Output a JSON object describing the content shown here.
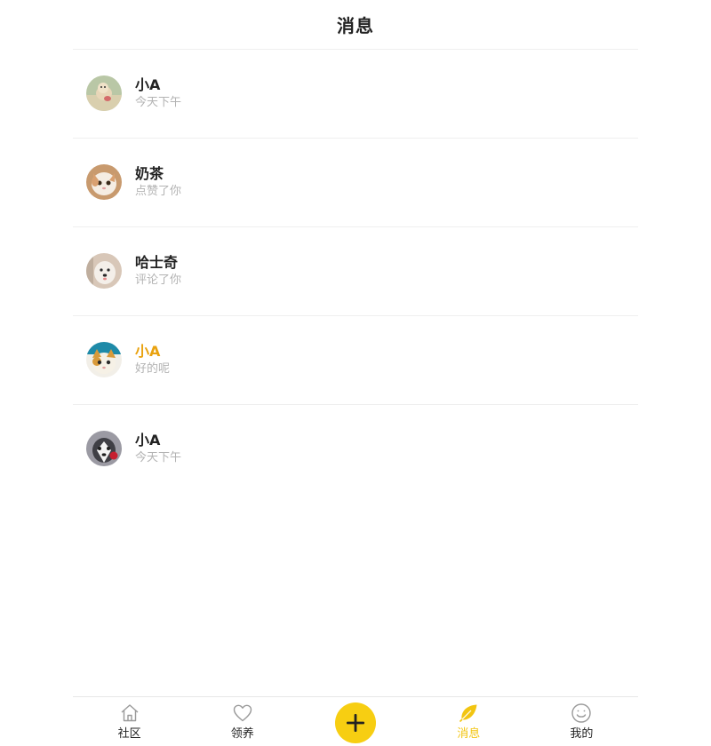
{
  "header": {
    "title": "消息"
  },
  "messages": [
    {
      "name": "小A",
      "subtitle": "今天下午",
      "highlight": false,
      "avatar": "dog-on-grass-avatar"
    },
    {
      "name": "奶茶",
      "subtitle": "点赞了你",
      "highlight": false,
      "avatar": "kitten-avatar"
    },
    {
      "name": "哈士奇",
      "subtitle": "评论了你",
      "highlight": false,
      "avatar": "white-puppy-avatar"
    },
    {
      "name": "小A",
      "subtitle": "好的呢",
      "highlight": true,
      "avatar": "cat-avatar"
    },
    {
      "name": "小A",
      "subtitle": "今天下午",
      "highlight": false,
      "avatar": "husky-avatar"
    }
  ],
  "tabbar": {
    "items": [
      {
        "label": "社区",
        "icon": "home-icon",
        "active": false
      },
      {
        "label": "领养",
        "icon": "heart-icon",
        "active": false
      },
      {
        "label": "",
        "icon": "plus-icon",
        "active": false
      },
      {
        "label": "消息",
        "icon": "leaf-icon",
        "active": true
      },
      {
        "label": "我的",
        "icon": "smile-icon",
        "active": false
      }
    ]
  },
  "colors": {
    "accent": "#f7ce12",
    "active_tab": "#f2c511",
    "highlight_name": "#e9a20f",
    "subtitle": "#b3b3b3",
    "divider": "#efefef"
  }
}
